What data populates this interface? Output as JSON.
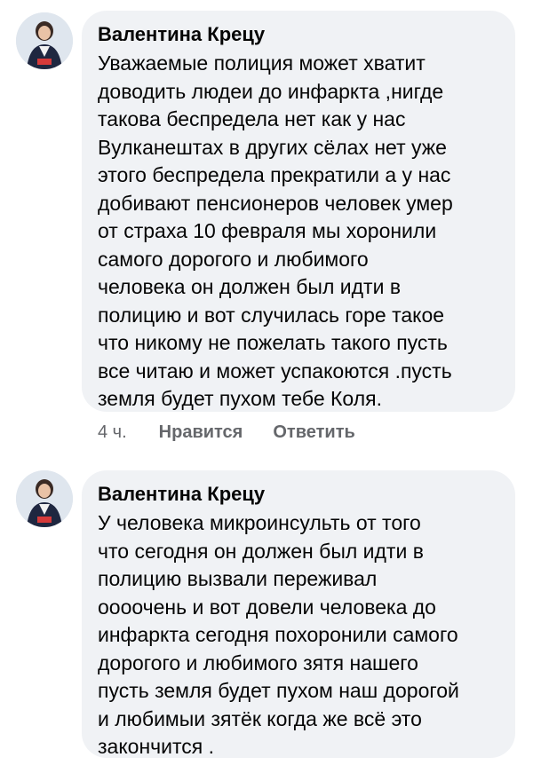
{
  "comments": [
    {
      "author": "Валентина Крецу",
      "lines": [
        "Уважаемые полиция может хватит",
        "доводить людеи до инфаркта ,нигде",
        "такова беспредела нет как у нас",
        "Вулканештах в других сёлах нет уже",
        "этого беспредела прекратили а у нас",
        "добивают пенсионеров человек умер",
        "от страха 10 февраля мы хоронили",
        "самого дорогого и любимого",
        "человека он должен был идти в",
        "полицию и вот случилась горе такое",
        "что никому не пожелать такого пусть",
        "все читаю и может успакоются .пусть",
        "земля будет пухом тебе Коля."
      ],
      "time": "4 ч.",
      "like_label": "Нравится",
      "reply_label": "Ответить"
    },
    {
      "author": "Валентина Крецу",
      "lines": [
        "У человека микроинсульть от того",
        "что сегодня он должен был идти в",
        "полицию вызвали переживал",
        "оооочень и вот довели человека до",
        "инфаркта сегодня похоронили самого",
        "дорогого и любимого зятя нашего",
        "пусть земля будет пухом наш дорогой",
        "и любимыи зятёк когда же всё это",
        "закончится ."
      ]
    }
  ],
  "colors": {
    "bubble": "#f0f2f5",
    "text": "#050505",
    "meta": "#65676b"
  },
  "icons": {
    "avatar": "user-avatar-photo"
  }
}
